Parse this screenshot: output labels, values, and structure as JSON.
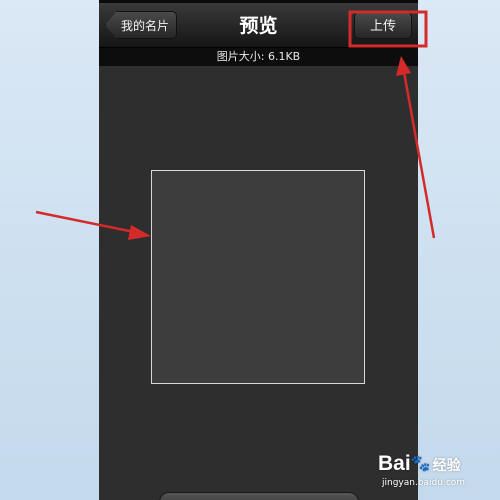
{
  "navbar": {
    "back_label": "我的名片",
    "title": "预览",
    "upload_label": "上传"
  },
  "info": {
    "image_size": "图片大小: 6.1KB"
  },
  "watermark": {
    "brand": "Bai",
    "paw": "🐾",
    "cn": "经验",
    "url": "jingyan.baidu.com"
  },
  "colors": {
    "annotation": "#d42a2a",
    "screen_background": "#2e2e2e",
    "navbar": "#1a1a1a"
  },
  "icons": {
    "watermark_logo": "paw-icon"
  }
}
